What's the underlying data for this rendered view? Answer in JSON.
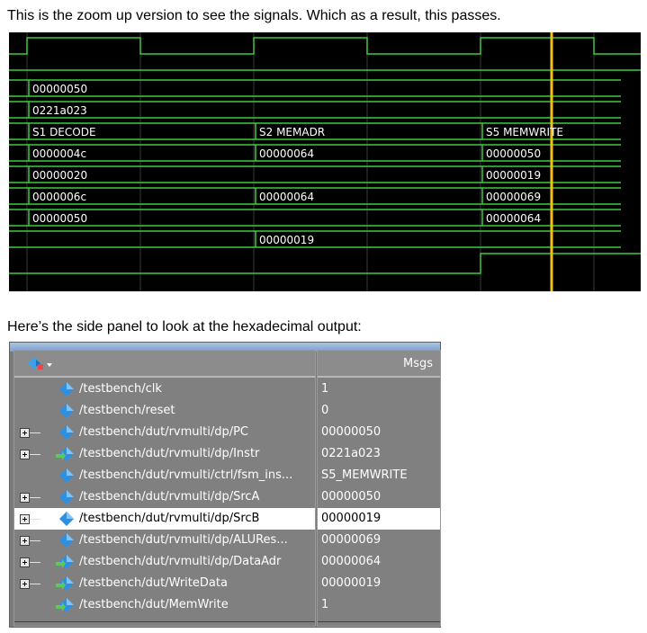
{
  "captions": {
    "top": "This is the zoom up version to see the signals. Which as a result, this passes.",
    "bottom": "Here’s the side panel to look at the hexadecimal output:"
  },
  "waveform": {
    "labels": {
      "pc": "00000050",
      "instr": "0221a023",
      "state_1": "S1 DECODE",
      "state_2": "S2 MEMADR",
      "state_3": "S5 MEMWRITE",
      "srca_1": "0000004c",
      "srca_3": "00000050",
      "srcb_1": "00000020",
      "srcb_3": "00000019",
      "alu_1": "0000006c",
      "alu_2": "00000064",
      "alu_3": "00000069",
      "data_1": "00000050",
      "data_3": "00000064",
      "writedata_2": "00000019"
    },
    "colors": {
      "background": "#000000",
      "signal": "#3ccc3c",
      "cursor": "#f2c21b",
      "grid": "#3a3a3a"
    }
  },
  "panel": {
    "header": "Msgs",
    "signals": [
      {
        "name": "/testbench/clk",
        "value": "1",
        "expandable": false,
        "icon": "signal-icon"
      },
      {
        "name": "/testbench/reset",
        "value": "0",
        "expandable": false,
        "icon": "signal-icon"
      },
      {
        "name": "/testbench/dut/rvmulti/dp/PC",
        "value": "00000050",
        "expandable": true,
        "icon": "signal-icon"
      },
      {
        "name": "/testbench/dut/rvmulti/dp/Instr",
        "value": "0221a023",
        "expandable": true,
        "icon": "input-signal-icon"
      },
      {
        "name": "/testbench/dut/rvmulti/ctrl/fsm_ins...",
        "value": "S5_MEMWRITE",
        "expandable": false,
        "icon": "signal-icon"
      },
      {
        "name": "/testbench/dut/rvmulti/dp/SrcA",
        "value": "00000050",
        "expandable": true,
        "icon": "signal-icon"
      },
      {
        "name": "/testbench/dut/rvmulti/dp/SrcB",
        "value": "00000019",
        "expandable": true,
        "icon": "signal-icon",
        "selected": true
      },
      {
        "name": "/testbench/dut/rvmulti/dp/ALURes...",
        "value": "00000069",
        "expandable": true,
        "icon": "signal-icon"
      },
      {
        "name": "/testbench/dut/rvmulti/dp/DataAdr",
        "value": "00000064",
        "expandable": true,
        "icon": "input-signal-icon"
      },
      {
        "name": "/testbench/dut/WriteData",
        "value": "00000019",
        "expandable": true,
        "icon": "input-signal-icon"
      },
      {
        "name": "/testbench/dut/MemWrite",
        "value": "1",
        "expandable": false,
        "icon": "input-signal-icon"
      }
    ]
  }
}
